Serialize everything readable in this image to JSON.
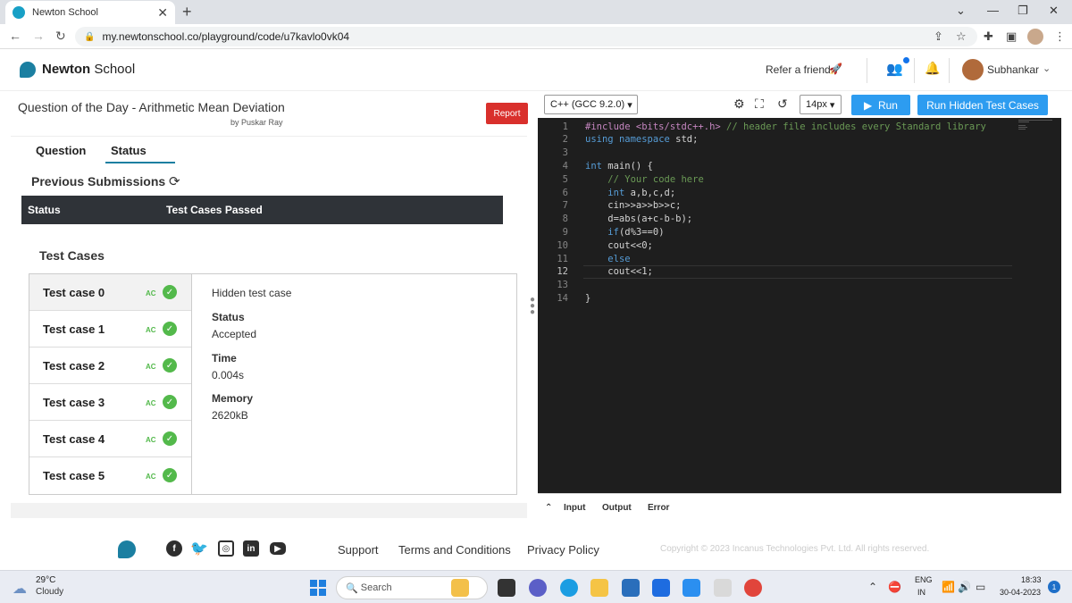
{
  "browser": {
    "tab_title": "Newton School",
    "tab_close": "✕",
    "new_tab": "+",
    "url": "my.newtonschool.co/playground/code/u7kavlo0vk04"
  },
  "header": {
    "brand_bold": "Newton",
    "brand_rest": " School",
    "refer": "Refer a friend",
    "user_name": "Subhankar"
  },
  "question": {
    "title": "Question of the Day - Arithmetic Mean Deviation",
    "author": "by Puskar Ray",
    "report_label": "Report"
  },
  "tabs": {
    "question": "Question",
    "status": "Status"
  },
  "submissions": {
    "heading": "Previous Submissions",
    "col_status": "Status",
    "col_passed": "Test Cases Passed"
  },
  "test_cases": {
    "heading": "Test Cases",
    "items": [
      {
        "name": "Test case 0",
        "verdict": "AC"
      },
      {
        "name": "Test case 1",
        "verdict": "AC"
      },
      {
        "name": "Test case 2",
        "verdict": "AC"
      },
      {
        "name": "Test case 3",
        "verdict": "AC"
      },
      {
        "name": "Test case 4",
        "verdict": "AC"
      },
      {
        "name": "Test case 5",
        "verdict": "AC"
      }
    ],
    "detail": {
      "hidden": "Hidden test case",
      "status_label": "Status",
      "status_value": "Accepted",
      "time_label": "Time",
      "time_value": "0.004s",
      "memory_label": "Memory",
      "memory_value": "2620kB"
    }
  },
  "editor": {
    "language": "C++ (GCC 9.2.0)",
    "font_size": "14px",
    "run_label": "Run",
    "run_hidden_label": "Run Hidden Test Cases",
    "current_line": 12,
    "lines": [
      "#include <bits/stdc++.h> // header file includes every Standard library",
      "using namespace std;",
      "",
      "int main() {",
      "    // Your code here",
      "    int a,b,c,d;",
      "    cin>>a>>b>>c;",
      "    d=abs(a+c-b-b);",
      "    if(d%3==0)",
      "    cout<<0;",
      "    else",
      "    cout<<1;",
      "",
      "}"
    ],
    "io": {
      "input": "Input",
      "output": "Output",
      "error": "Error"
    }
  },
  "footer": {
    "support": "Support",
    "terms": "Terms and Conditions",
    "privacy": "Privacy Policy",
    "copyright": "Copyright © 2023 Incanus Technologies Pvt. Ltd. All rights reserved."
  },
  "taskbar": {
    "temp": "29°C",
    "condition": "Cloudy",
    "search": "Search",
    "lang_top": "ENG",
    "lang_bottom": "IN",
    "time": "18:33",
    "date": "30-04-2023",
    "notifications": "1"
  }
}
